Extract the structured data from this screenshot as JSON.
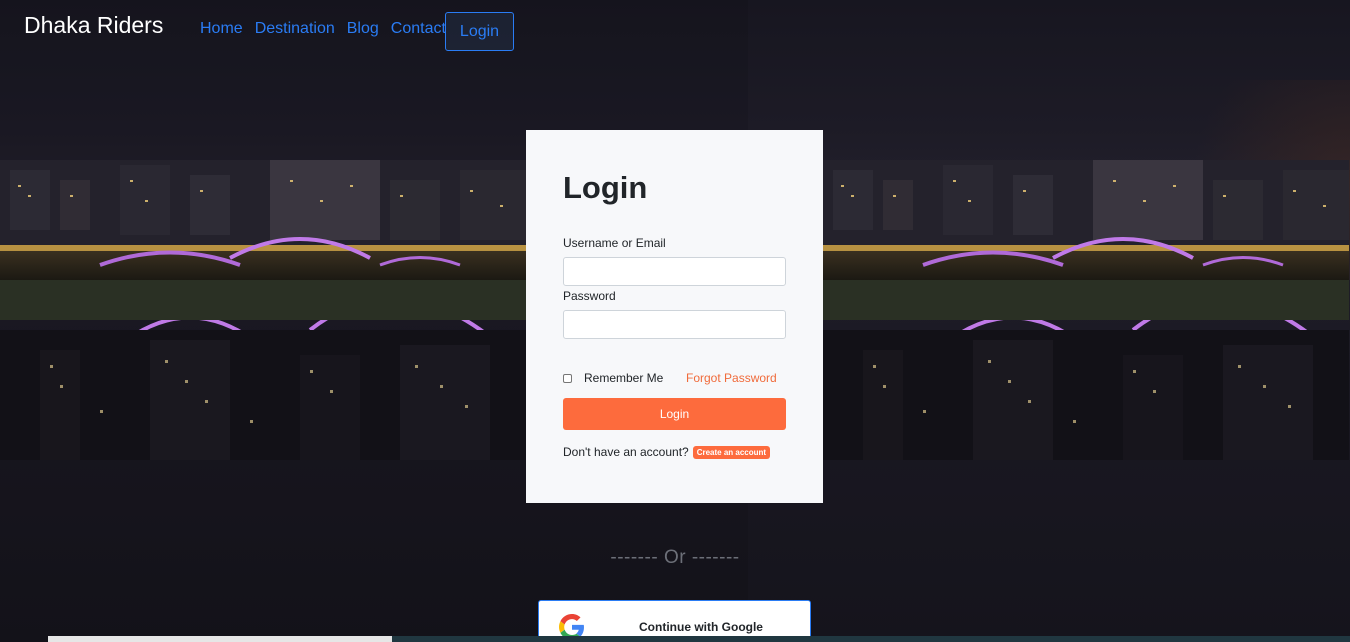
{
  "navbar": {
    "brand": "Dhaka Riders",
    "links": [
      "Home",
      "Destination",
      "Blog",
      "Contact"
    ],
    "login_button": "Login"
  },
  "login_form": {
    "title": "Login",
    "username_label": "Username or Email",
    "username_value": "",
    "password_label": "Password",
    "password_value": "",
    "remember_label": "Remember Me",
    "forgot_link": "Forgot Password",
    "submit_label": "Login",
    "signup_prompt": "Don't have an account?",
    "signup_link": "Create an account"
  },
  "divider_text": "------- Or -------",
  "google_button": {
    "label": "Continue with Google",
    "icon": "google-g-icon"
  },
  "colors": {
    "accent": "#fd6b3d",
    "nav_link": "#2a7cf4",
    "card_bg": "#f7f8fa"
  }
}
